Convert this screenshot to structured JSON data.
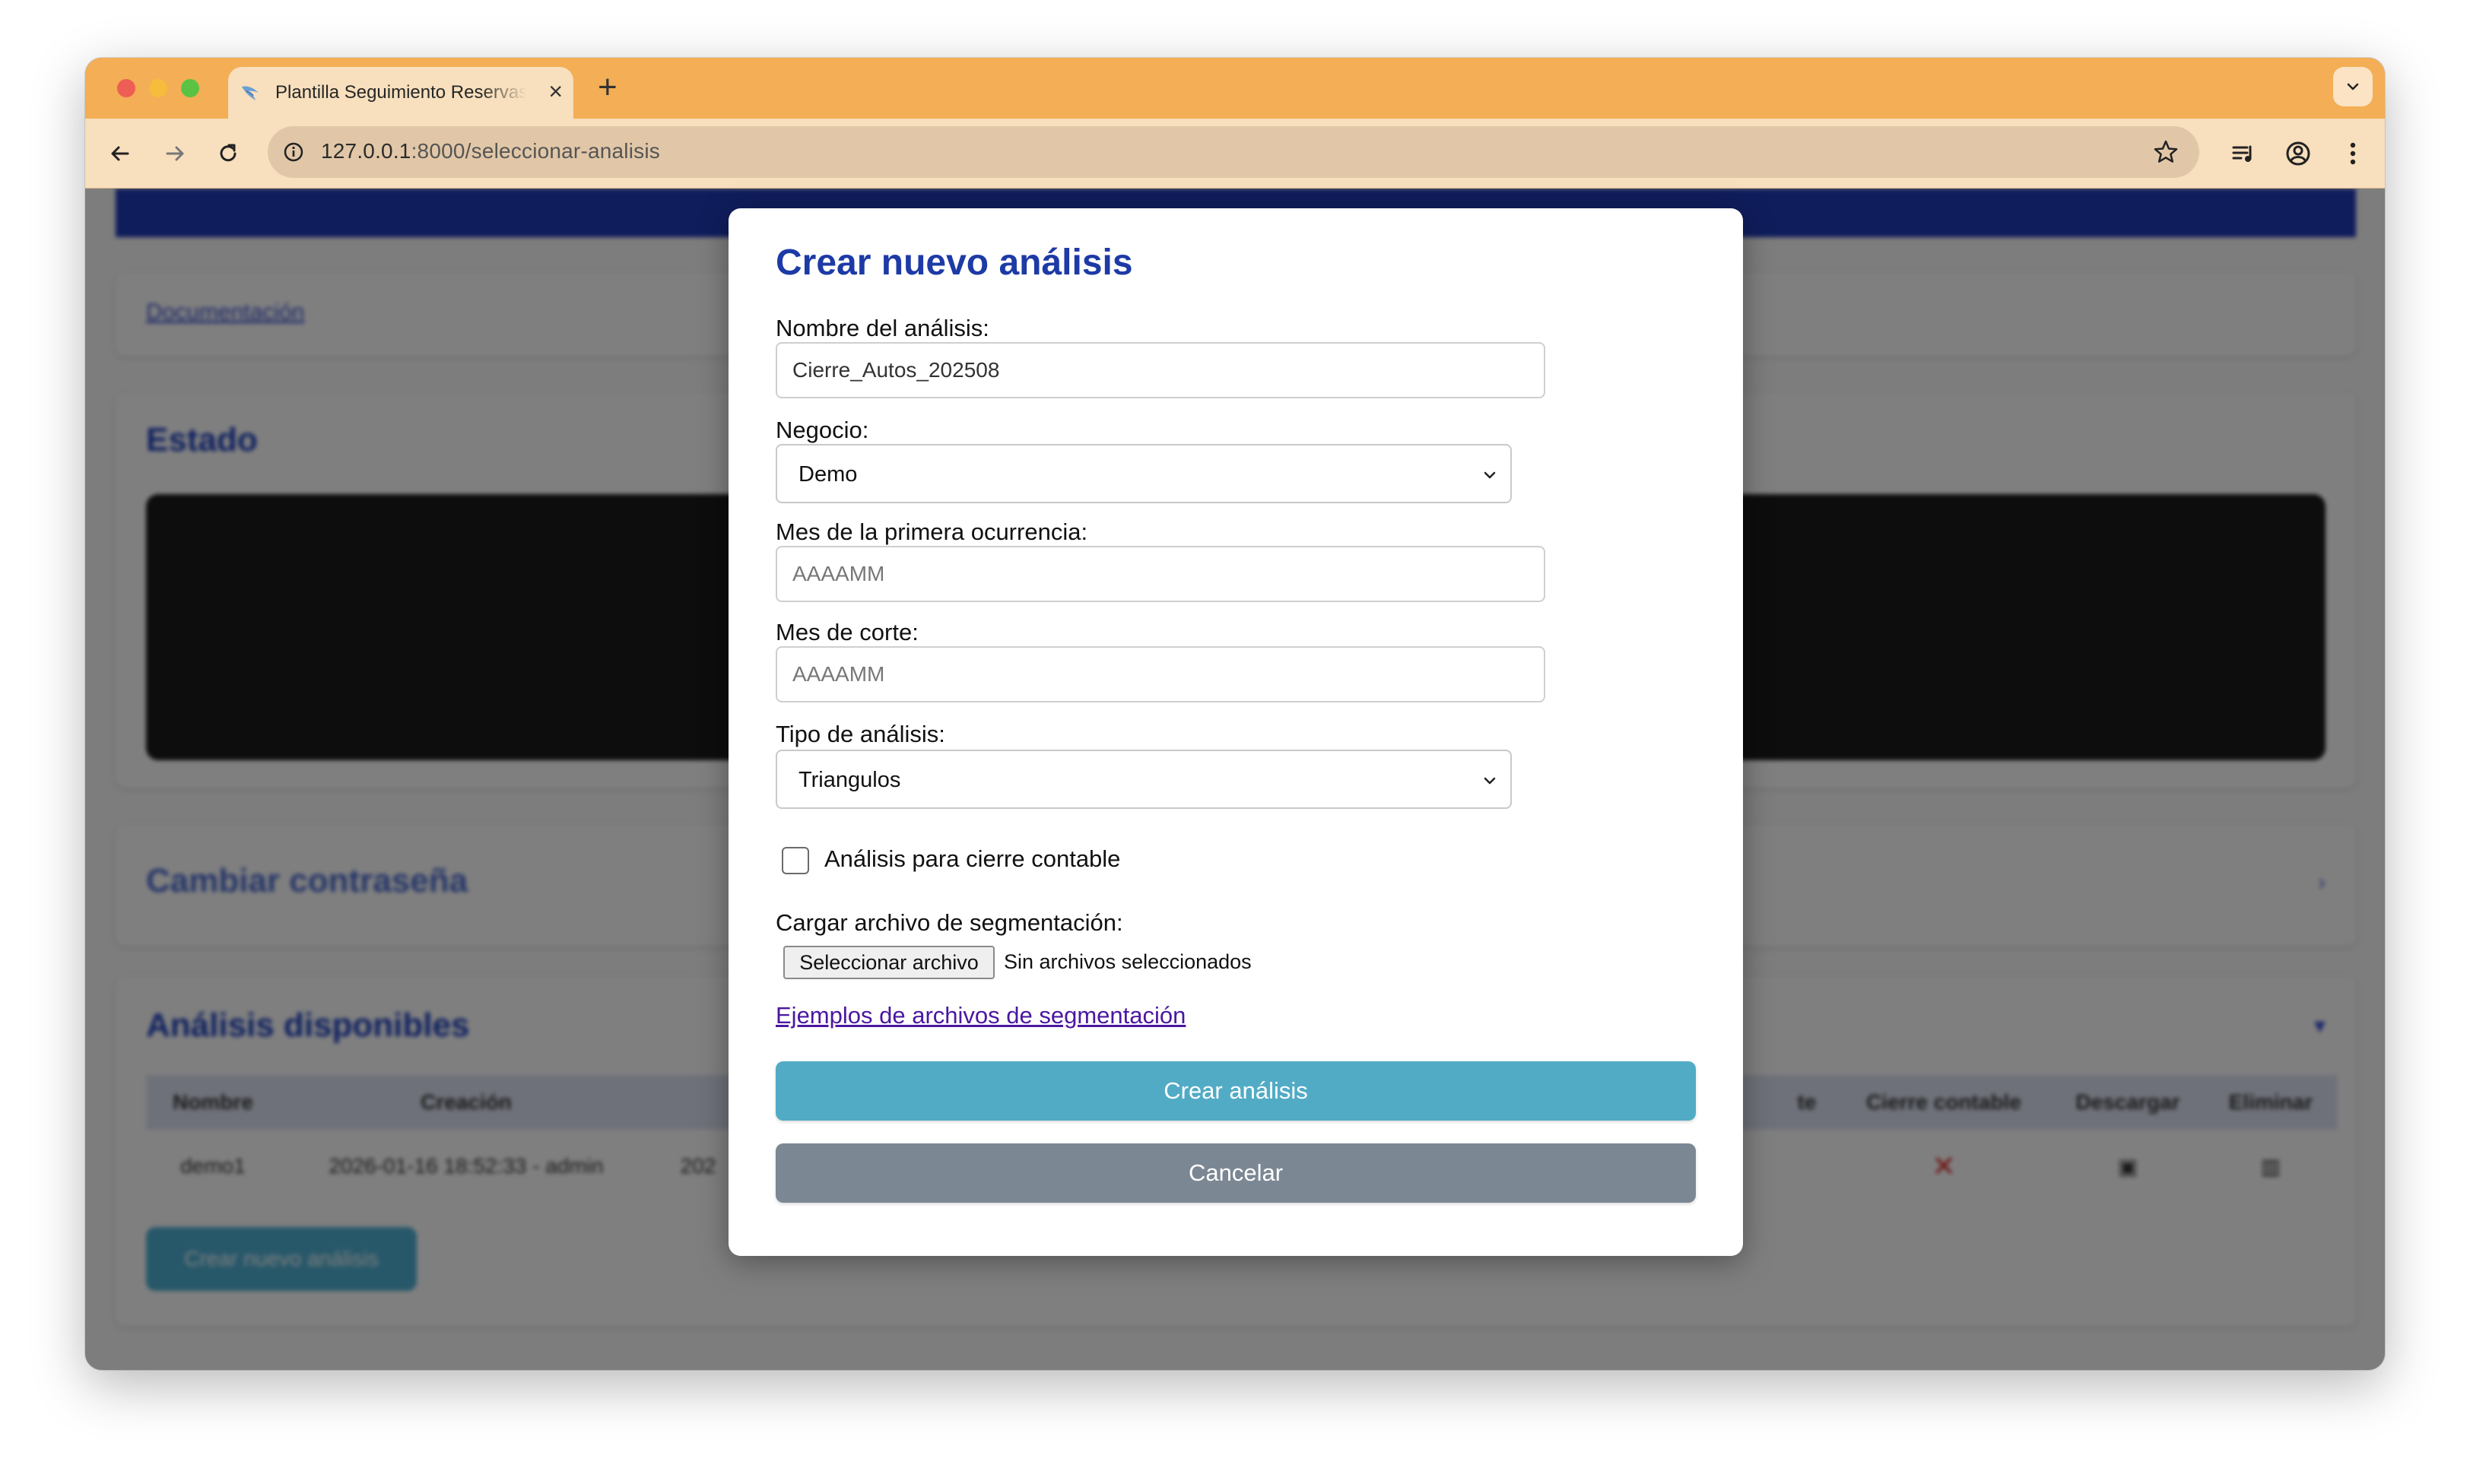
{
  "browser": {
    "tab_title": "Plantilla Seguimiento Reservas",
    "url_host": "127.0.0.1",
    "url_rest": ":8000/seleccionar-analisis"
  },
  "background": {
    "doc_link": "Documentación",
    "estado_title": "Estado",
    "password_title": "Cambiar contraseña",
    "analisis_title": "Análisis disponibles",
    "table_headers": [
      "Nombre",
      "Creación",
      "",
      "te",
      "Cierre contable",
      "Descargar",
      "Eliminar"
    ],
    "table_row": [
      "demo1",
      "2026-01-16 18:52:33 - admin",
      "202"
    ],
    "new_button": "Crear nuevo análisis"
  },
  "modal": {
    "title": "Crear nuevo análisis",
    "name_label": "Nombre del análisis:",
    "name_value": "Cierre_Autos_202508",
    "negocio_label": "Negocio:",
    "negocio_value": "Demo",
    "mes_primera_label": "Mes de la primera ocurrencia:",
    "mes_primera_placeholder": "AAAAMM",
    "mes_corte_label": "Mes de corte:",
    "mes_corte_placeholder": "AAAAMM",
    "tipo_label": "Tipo de análisis:",
    "tipo_value": "Triangulos",
    "cierre_label": "Análisis para cierre contable",
    "cierre_checked": false,
    "segmentacion_label": "Cargar archivo de segmentación:",
    "file_button": "Seleccionar archivo",
    "file_status": "Sin archivos seleccionados",
    "examples_link": "Ejemplos de archivos de segmentación",
    "submit_button": "Crear análisis",
    "cancel_button": "Cancelar"
  },
  "colors": {
    "tabbar": "#f3ae56",
    "toolbar": "#f8dfbd",
    "modal_title": "#1d3aa6",
    "primary_button": "#51abc5",
    "cancel_button": "#7b8793",
    "link": "#4b17a0"
  }
}
